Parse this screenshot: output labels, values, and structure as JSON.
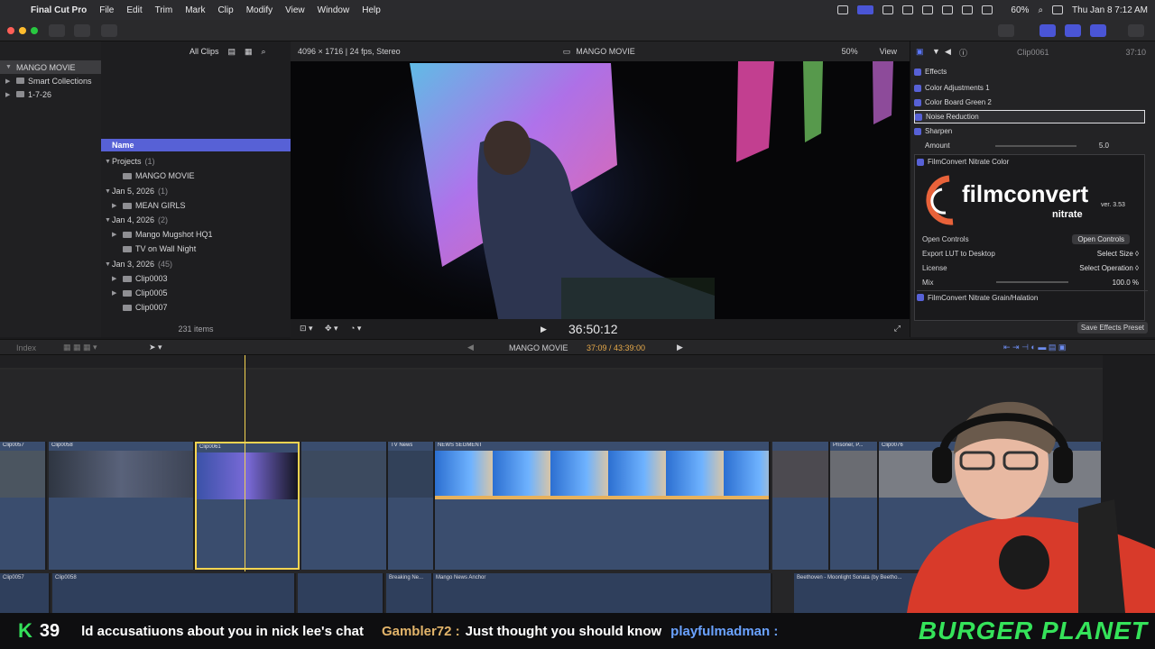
{
  "menubar": {
    "app": "Final Cut Pro",
    "items": [
      "File",
      "Edit",
      "Trim",
      "Mark",
      "Clip",
      "Modify",
      "View",
      "Window",
      "Help"
    ],
    "battery": "60%",
    "datetime": "Thu Jan 8  7:12 AM"
  },
  "library": {
    "items": [
      {
        "label": "MANGO MOVIE"
      },
      {
        "label": "Smart Collections"
      },
      {
        "label": "1-7-26"
      }
    ]
  },
  "browser": {
    "filter": "All Clips",
    "column_header": "Name",
    "rows": [
      {
        "label": "Projects",
        "count": "(1)"
      },
      {
        "label": "MANGO MOVIE",
        "count": ""
      },
      {
        "label": "Jan 5, 2026",
        "count": "(1)"
      },
      {
        "label": "MEAN GIRLS",
        "count": ""
      },
      {
        "label": "Jan 4, 2026",
        "count": "(2)"
      },
      {
        "label": "Mango Mugshot HQ1",
        "count": ""
      },
      {
        "label": "TV on Wall Night",
        "count": ""
      },
      {
        "label": "Jan 3, 2026",
        "count": "(45)"
      },
      {
        "label": "Clip0003",
        "count": ""
      },
      {
        "label": "Clip0005",
        "count": ""
      },
      {
        "label": "Clip0007",
        "count": ""
      }
    ],
    "item_count": "231 items"
  },
  "viewer": {
    "format": "4096 × 1716 | 24 fps, Stereo",
    "title": "MANGO MOVIE",
    "zoom": "50%",
    "view_menu": "View",
    "timecode": "36:50:12"
  },
  "inspector": {
    "clip_name": "Clip0061",
    "duration": "37:10",
    "effects_label": "Effects",
    "effects": [
      {
        "label": "Color Adjustments 1"
      },
      {
        "label": "Color Board Green 2"
      },
      {
        "label": "Noise Reduction"
      },
      {
        "label": "Sharpen"
      }
    ],
    "amount_label": "Amount",
    "amount_value": "5.0",
    "filmconvert": {
      "header": "FilmConvert Nitrate Color",
      "logo": "filmconvert",
      "sub": "nitrate",
      "version": "ver. 3.53",
      "rows": [
        {
          "label": "Open Controls",
          "value": "Open Controls"
        },
        {
          "label": "Export LUT to Desktop",
          "value": "Select Size ◊"
        },
        {
          "label": "License",
          "value": "Select Operation ◊"
        },
        {
          "label": "Mix",
          "value": "100.0 %"
        }
      ],
      "grain_header": "FilmConvert Nitrate Grain/Halation"
    },
    "save_preset": "Save Effects Preset"
  },
  "timeline": {
    "index": "Index",
    "project": "MANGO MOVIE",
    "position": "37:09 / 43:39:00",
    "clips_v": [
      {
        "label": "Clip0057"
      },
      {
        "label": "Clip0058"
      },
      {
        "label": "Clip0061"
      },
      {
        "label": "TV News"
      },
      {
        "label": "NEWS SEGMENT"
      },
      {
        "label": "Prisoner, P..."
      },
      {
        "label": "Clip0076"
      }
    ],
    "clips_a": [
      {
        "label": "Clip0057"
      },
      {
        "label": "Clip0058"
      },
      {
        "label": "Breaking Ne..."
      },
      {
        "label": "Mango News Anchor"
      },
      {
        "label": "Beethoven - Moonlight Sonata (by Beetho..."
      }
    ]
  },
  "ticker": {
    "k": "K",
    "count": "39",
    "message": "ld accusatiuons about you in nick lee's chat",
    "user": "Gambler72 :",
    "user_msg": "Just thought you should know",
    "user2": "playfulmadman :",
    "brand": "BURGER PLANET"
  }
}
